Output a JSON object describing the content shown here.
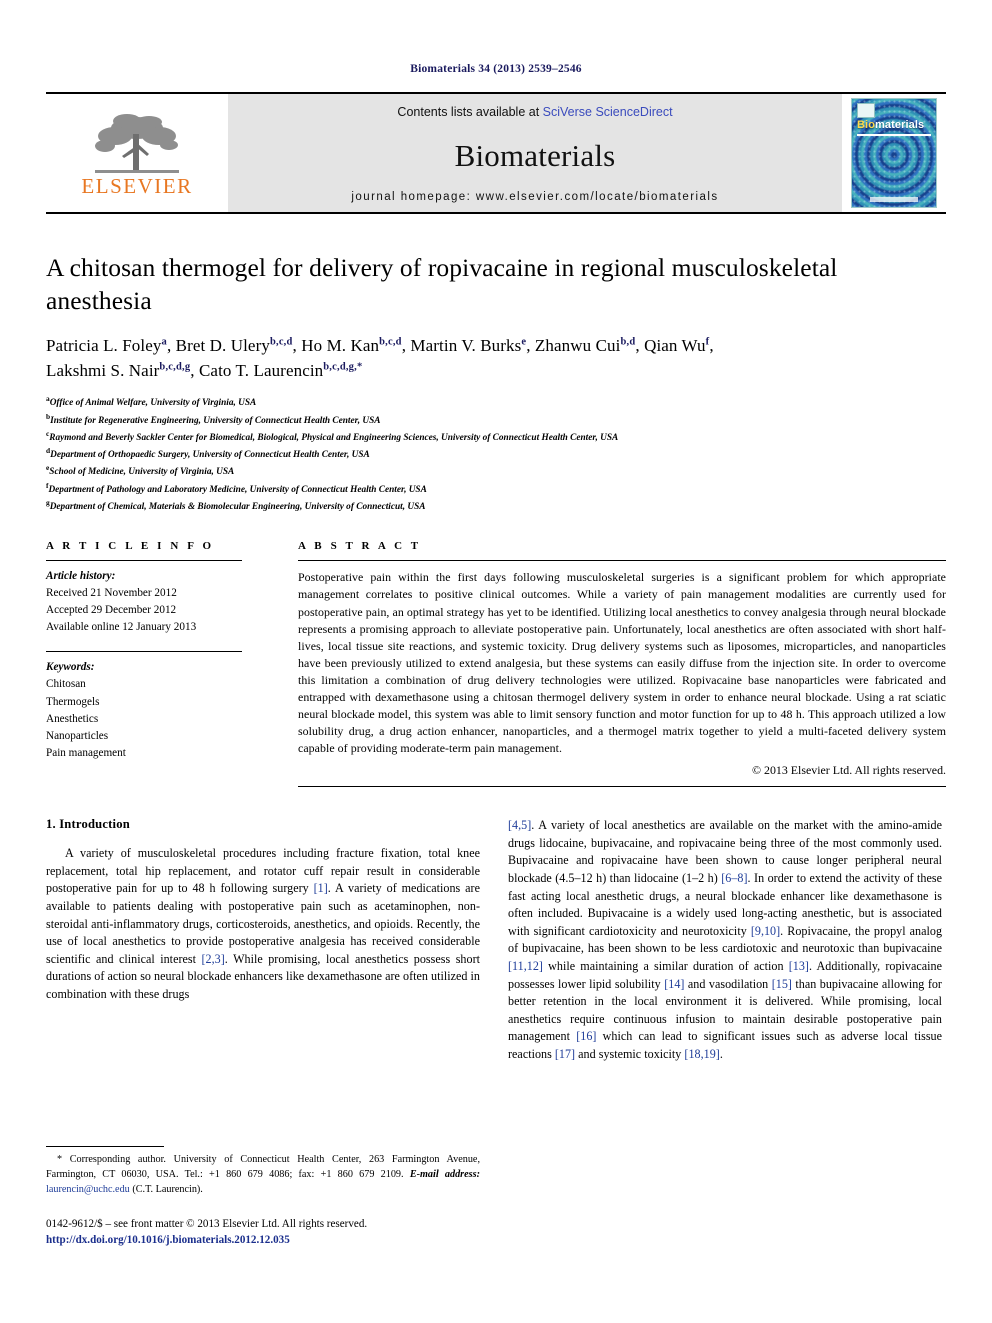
{
  "running_head": "Biomaterials 34 (2013) 2539–2546",
  "masthead": {
    "publisher_logo_text": "ELSEVIER",
    "contents_prefix": "Contents lists available at ",
    "contents_link": "SciVerse ScienceDirect",
    "journal_name": "Biomaterials",
    "homepage_line": "journal homepage: www.elsevier.com/locate/biomaterials",
    "cover": {
      "title_part1": "Bio",
      "title_part2": "materials",
      "background_color": "#2fa6a6",
      "ring_color": "#163a8c"
    },
    "logo_color": "#E87722",
    "link_color": "#3a4bbd"
  },
  "article": {
    "title": "A chitosan thermogel for delivery of ropivacaine in regional musculoskeletal anesthesia",
    "authors_line1_parts": [
      {
        "name": "Patricia L. Foley",
        "sup": "a"
      },
      {
        "name": "Bret D. Ulery",
        "sup": "b,c,d"
      },
      {
        "name": "Ho M. Kan",
        "sup": "b,c,d"
      },
      {
        "name": "Martin V. Burks",
        "sup": "e"
      },
      {
        "name": "Zhanwu Cui",
        "sup": "b,d"
      },
      {
        "name": "Qian Wu",
        "sup": "f"
      }
    ],
    "authors_line2_parts": [
      {
        "name": "Lakshmi S. Nair",
        "sup": "b,c,d,g"
      },
      {
        "name": "Cato T. Laurencin",
        "sup": "b,c,d,g,*"
      }
    ],
    "affiliations": [
      {
        "mark": "a",
        "text": "Office of Animal Welfare, University of Virginia, USA"
      },
      {
        "mark": "b",
        "text": "Institute for Regenerative Engineering, University of Connecticut Health Center, USA"
      },
      {
        "mark": "c",
        "text": "Raymond and Beverly Sackler Center for Biomedical, Biological, Physical and Engineering Sciences, University of Connecticut Health Center, USA"
      },
      {
        "mark": "d",
        "text": "Department of Orthopaedic Surgery, University of Connecticut Health Center, USA"
      },
      {
        "mark": "e",
        "text": "School of Medicine, University of Virginia, USA"
      },
      {
        "mark": "f",
        "text": "Department of Pathology and Laboratory Medicine, University of Connecticut Health Center, USA"
      },
      {
        "mark": "g",
        "text": "Department of Chemical, Materials & Biomolecular Engineering, University of Connecticut, USA"
      }
    ]
  },
  "article_info": {
    "heading": "A R T I C L E  I N F O",
    "history_label": "Article history:",
    "received": "Received 21 November 2012",
    "accepted": "Accepted 29 December 2012",
    "available": "Available online 12 January 2013",
    "keywords_label": "Keywords:",
    "keywords": [
      "Chitosan",
      "Thermogels",
      "Anesthetics",
      "Nanoparticles",
      "Pain management"
    ]
  },
  "abstract": {
    "heading": "A B S T R A C T",
    "text": "Postoperative pain within the first days following musculoskeletal surgeries is a significant problem for which appropriate management correlates to positive clinical outcomes. While a variety of pain management modalities are currently used for postoperative pain, an optimal strategy has yet to be identified. Utilizing local anesthetics to convey analgesia through neural blockade represents a promising approach to alleviate postoperative pain. Unfortunately, local anesthetics are often associated with short half-lives, local tissue site reactions, and systemic toxicity. Drug delivery systems such as liposomes, microparticles, and nanoparticles have been previously utilized to extend analgesia, but these systems can easily diffuse from the injection site. In order to overcome this limitation a combination of drug delivery technologies were utilized. Ropivacaine base nanoparticles were fabricated and entrapped with dexamethasone using a chitosan thermogel delivery system in order to enhance neural blockade. Using a rat sciatic neural blockade model, this system was able to limit sensory function and motor function for up to 48 h. This approach utilized a low solubility drug, a drug action enhancer, nanoparticles, and a thermogel matrix together to yield a multi-faceted delivery system capable of providing moderate-term pain management.",
    "copyright": "© 2013 Elsevier Ltd. All rights reserved."
  },
  "introduction": {
    "heading": "1.  Introduction",
    "left_paragraph_parts": [
      "A variety of musculoskeletal procedures including fracture fixation, total knee replacement, total hip replacement, and rotator cuff repair result in considerable postoperative pain for up to 48 h following surgery ",
      "[1]",
      ". A variety of medications are available to patients dealing with postoperative pain such as acetaminophen, non-steroidal anti-inflammatory drugs, corticosteroids, anesthetics, and opioids. Recently, the use of local anesthetics to provide postoperative analgesia has received considerable scientific and clinical interest ",
      "[2,3]",
      ". While promising, local anesthetics possess short durations of action so neural blockade enhancers like dexamethasone are often utilized in combination with these drugs"
    ],
    "right_paragraph_parts": [
      "[4,5]",
      ". A variety of local anesthetics are available on the market with the amino-amide drugs lidocaine, bupivacaine, and ropivacaine being three of the most commonly used. Bupivacaine and ropivacaine have been shown to cause longer peripheral neural blockade (4.5–12 h) than lidocaine (1–2 h) ",
      "[6–8]",
      ". In order to extend the activity of these fast acting local anesthetic drugs, a neural blockade enhancer like dexamethasone is often included. Bupivacaine is a widely used long-acting anesthetic, but is associated with significant cardiotoxicity and neurotoxicity ",
      "[9,10]",
      ". Ropivacaine, the propyl analog of bupivacaine, has been shown to be less cardiotoxic and neurotoxic than bupivacaine ",
      "[11,12]",
      " while maintaining a similar duration of action ",
      "[13]",
      ". Additionally, ropivacaine possesses lower lipid solubility ",
      "[14]",
      " and vasodilation ",
      "[15]",
      " than bupivacaine allowing for better retention in the local environment it is delivered. While promising, local anesthetics require continuous infusion to maintain desirable postoperative pain management ",
      "[16]",
      " which can lead to significant issues such as adverse local tissue reactions ",
      "[17]",
      " and systemic toxicity ",
      "[18,19]",
      "."
    ]
  },
  "footnote": {
    "corresponding": "* Corresponding author. University of Connecticut Health Center, 263 Farmington Avenue, Farmington, CT 06030, USA. Tel.: +1 860 679 4086; fax: +1 860 679 2109.",
    "email_label": "E-mail address:",
    "email": "laurencin@uchc.edu",
    "email_suffix": "(C.T. Laurencin)."
  },
  "footer": {
    "front_matter": "0142-9612/$ – see front matter © 2013 Elsevier Ltd. All rights reserved.",
    "doi": "http://dx.doi.org/10.1016/j.biomaterials.2012.12.035"
  }
}
